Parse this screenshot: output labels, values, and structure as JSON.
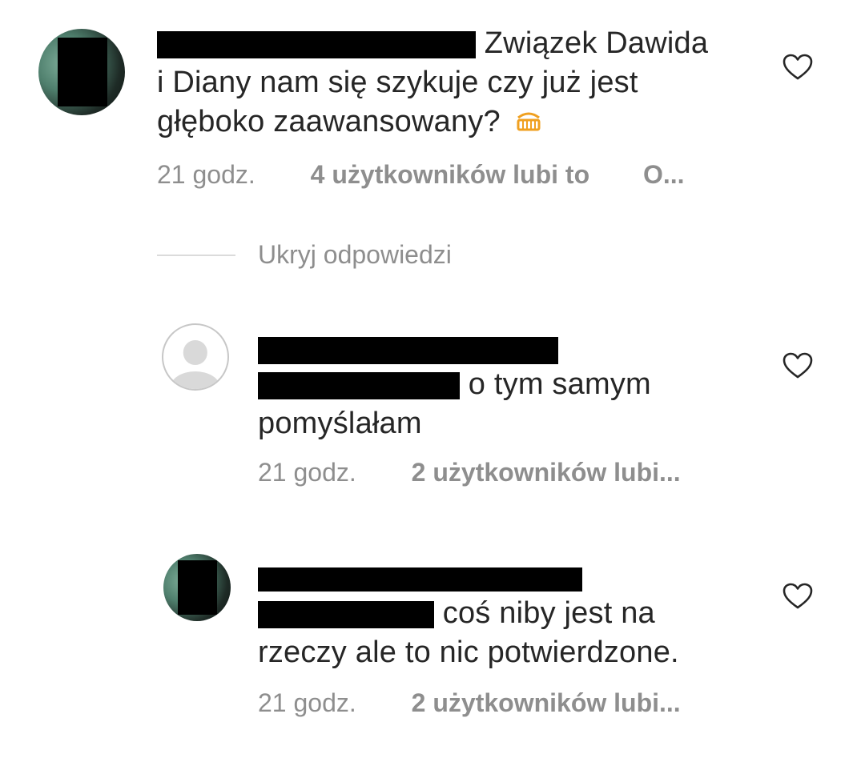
{
  "comments": [
    {
      "text": "Związek Dawida i Diany nam się szykuje czy już jest głęboko zaawansowany?",
      "line1": "Związek Dawida",
      "line2": "i Diany nam się szykuje czy już jest",
      "line3": "głęboko zaawansowany?",
      "emoji": "grinning-face-icon",
      "time": "21 godz.",
      "likes": "4 użytkowników lubi to",
      "reply": "O..."
    }
  ],
  "hide_replies_label": "Ukryj odpowiedzi",
  "replies": [
    {
      "line2_tail": "o tym samym",
      "line3": "pomyślałam",
      "time": "21 godz.",
      "likes": "2 użytkowników lubi..."
    },
    {
      "line2_tail": "coś niby jest na",
      "line3": "rzeczy ale to nic potwierdzone.",
      "time": "21 godz.",
      "likes": "2 użytkowników lubi..."
    }
  ],
  "icons": {
    "like": "heart-outline-icon",
    "avatar_default": "default-user-icon"
  },
  "colors": {
    "text": "#262626",
    "meta": "#8e8e8e",
    "mention": "#385898",
    "divider": "#dbdbdb",
    "emoji": "#f0a020"
  }
}
